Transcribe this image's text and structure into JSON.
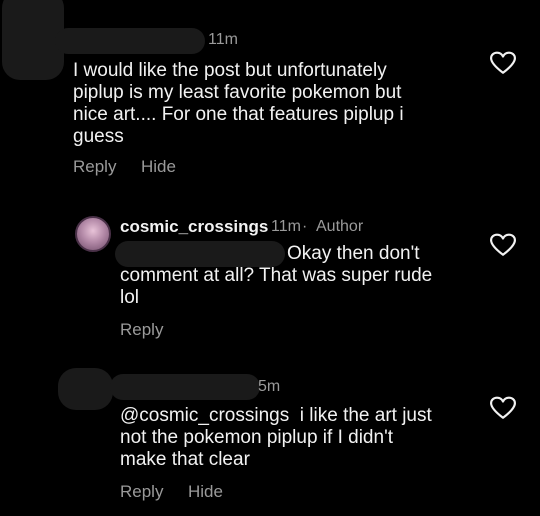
{
  "comments": [
    {
      "time": "11m",
      "text": "I would like the post but unfortunately piplup is my least favorite pokemon but nice art.... For one that features piplup i guess",
      "reply_label": "Reply",
      "hide_label": "Hide"
    },
    {
      "username": "cosmic_crossings",
      "time": "11m",
      "separator": "·",
      "author_label": "Author",
      "text_line1": "Okay then don't",
      "text_line2": "comment at all? That was super rude",
      "text_line3": "lol",
      "reply_label": "Reply"
    },
    {
      "time": "5m",
      "mention": "@cosmic_crossings",
      "text_line1": "i like the art just",
      "text_line2": "not the pokemon piplup if I didn't",
      "text_line3": "make that clear",
      "reply_label": "Reply",
      "hide_label": "Hide"
    }
  ],
  "icons": {
    "like": "heart-icon"
  },
  "colors": {
    "background": "#000000",
    "text": "#f2f2f2",
    "muted": "#9a9a9a"
  }
}
